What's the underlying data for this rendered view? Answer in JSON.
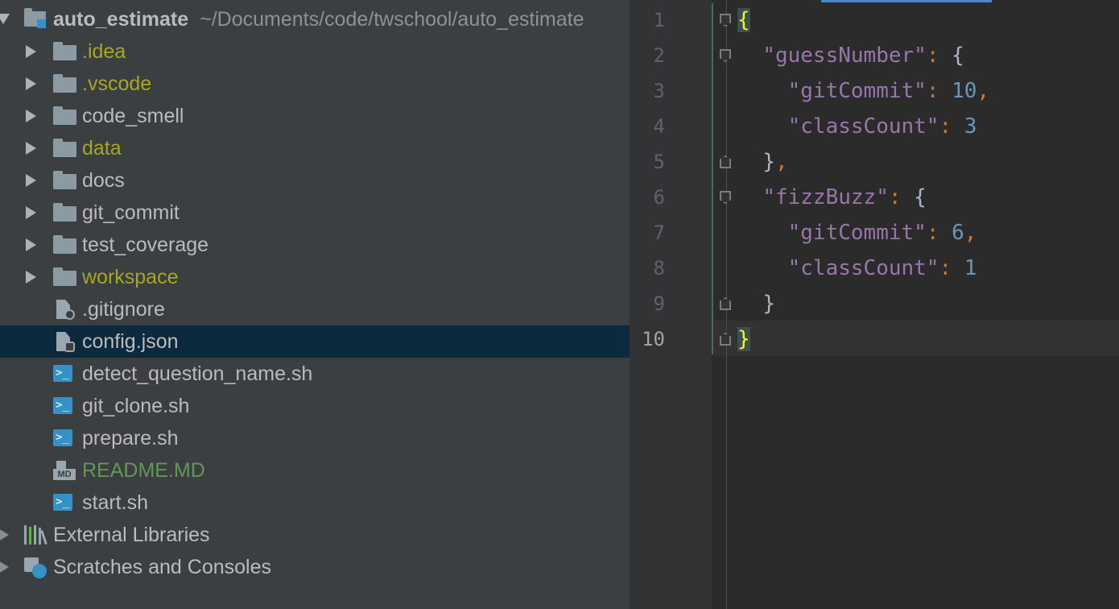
{
  "tree": {
    "root": {
      "name": "auto_estimate",
      "path": "~/Documents/code/twschool/auto_estimate"
    },
    "items": [
      {
        "name": ".idea",
        "type": "folder",
        "color": "#a7a723"
      },
      {
        "name": ".vscode",
        "type": "folder",
        "color": "#a7a723"
      },
      {
        "name": "code_smell",
        "type": "folder",
        "color": "#bbbbbb"
      },
      {
        "name": "data",
        "type": "folder",
        "color": "#a7a723"
      },
      {
        "name": "docs",
        "type": "folder",
        "color": "#bbbbbb"
      },
      {
        "name": "git_commit",
        "type": "folder",
        "color": "#bbbbbb"
      },
      {
        "name": "test_coverage",
        "type": "folder",
        "color": "#bbbbbb"
      },
      {
        "name": "workspace",
        "type": "folder",
        "color": "#a7a723"
      },
      {
        "name": ".gitignore",
        "type": "ignore-file",
        "color": "#bbbbbb"
      },
      {
        "name": "config.json",
        "type": "json-file",
        "color": "#bbbbbb",
        "selected": true
      },
      {
        "name": "detect_question_name.sh",
        "type": "shell-file",
        "color": "#bbbbbb"
      },
      {
        "name": "git_clone.sh",
        "type": "shell-file",
        "color": "#bbbbbb"
      },
      {
        "name": "prepare.sh",
        "type": "shell-file",
        "color": "#bbbbbb"
      },
      {
        "name": "README.MD",
        "type": "markdown-file",
        "color": "#629755"
      },
      {
        "name": "start.sh",
        "type": "shell-file",
        "color": "#bbbbbb"
      }
    ],
    "external_libraries": "External Libraries",
    "scratches": "Scratches and Consoles"
  },
  "editor": {
    "line_numbers": [
      "1",
      "2",
      "3",
      "4",
      "5",
      "6",
      "7",
      "8",
      "9",
      "10"
    ],
    "current_line": "10",
    "lines": [
      {
        "tokens": [
          {
            "t": "{",
            "c": "brace-hl"
          }
        ]
      },
      {
        "tokens": [
          {
            "t": "  ",
            "c": "b"
          },
          {
            "t": "\"guessNumber\"",
            "c": "k"
          },
          {
            "t": ": ",
            "c": "p"
          },
          {
            "t": "{",
            "c": "b"
          }
        ]
      },
      {
        "tokens": [
          {
            "t": "    ",
            "c": "b"
          },
          {
            "t": "\"gitCommit\"",
            "c": "k"
          },
          {
            "t": ": ",
            "c": "p"
          },
          {
            "t": "10",
            "c": "n"
          },
          {
            "t": ",",
            "c": "p"
          }
        ]
      },
      {
        "tokens": [
          {
            "t": "    ",
            "c": "b"
          },
          {
            "t": "\"classCount\"",
            "c": "k"
          },
          {
            "t": ": ",
            "c": "p"
          },
          {
            "t": "3",
            "c": "n"
          }
        ]
      },
      {
        "tokens": [
          {
            "t": "  ",
            "c": "b"
          },
          {
            "t": "}",
            "c": "b"
          },
          {
            "t": ",",
            "c": "p"
          }
        ]
      },
      {
        "tokens": [
          {
            "t": "  ",
            "c": "b"
          },
          {
            "t": "\"fizzBuzz\"",
            "c": "k"
          },
          {
            "t": ": ",
            "c": "p"
          },
          {
            "t": "{",
            "c": "b"
          }
        ]
      },
      {
        "tokens": [
          {
            "t": "    ",
            "c": "b"
          },
          {
            "t": "\"gitCommit\"",
            "c": "k"
          },
          {
            "t": ": ",
            "c": "p"
          },
          {
            "t": "6",
            "c": "n"
          },
          {
            "t": ",",
            "c": "p"
          }
        ]
      },
      {
        "tokens": [
          {
            "t": "    ",
            "c": "b"
          },
          {
            "t": "\"classCount\"",
            "c": "k"
          },
          {
            "t": ": ",
            "c": "p"
          },
          {
            "t": "1",
            "c": "n"
          }
        ]
      },
      {
        "tokens": [
          {
            "t": "  ",
            "c": "b"
          },
          {
            "t": "}",
            "c": "b"
          }
        ]
      },
      {
        "tokens": [
          {
            "t": "}",
            "c": "brace-hl"
          }
        ]
      }
    ],
    "fold_markers": [
      "open",
      "open",
      "",
      "",
      "close",
      "open",
      "",
      "",
      "close",
      "close"
    ]
  }
}
